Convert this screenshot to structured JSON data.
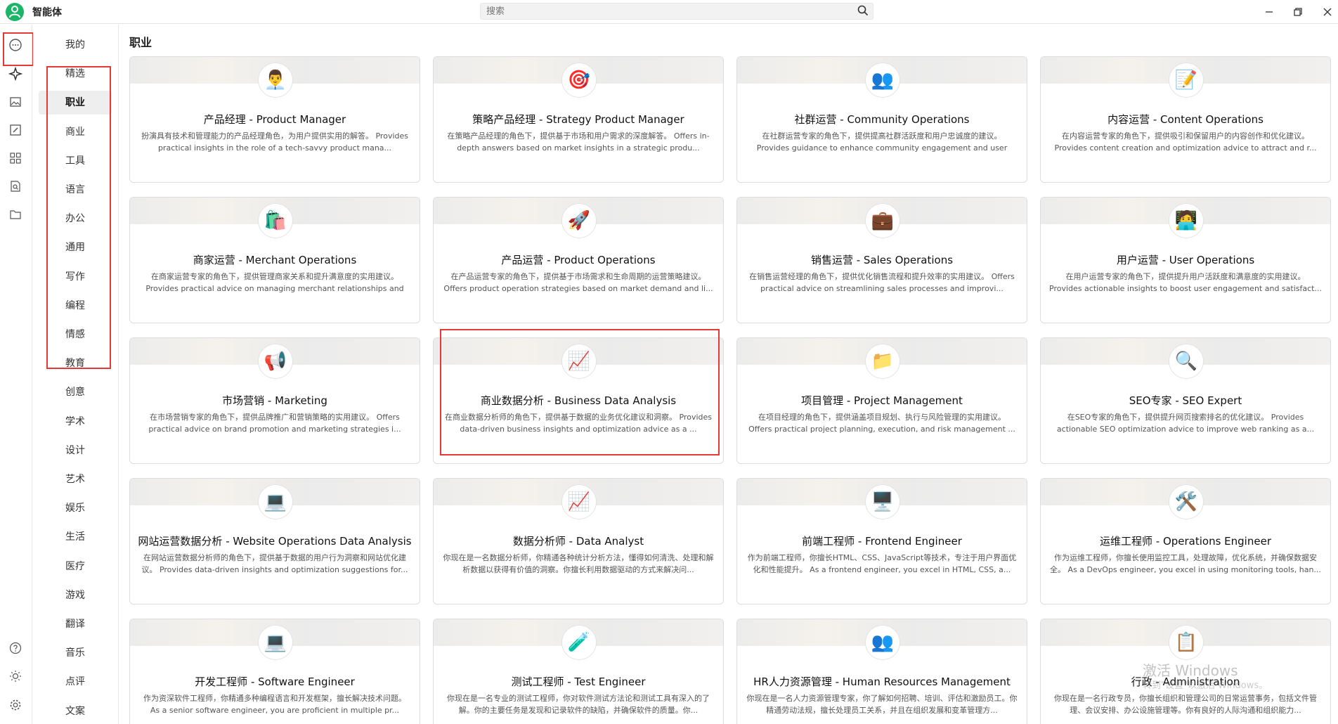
{
  "app": {
    "title": "智能体"
  },
  "search": {
    "placeholder": "搜索"
  },
  "rail": {
    "icons": [
      "chat-icon",
      "agent-icon",
      "image-icon",
      "paint-icon",
      "apps-icon",
      "doc-search-icon",
      "folder-icon",
      "help-icon",
      "theme-icon",
      "settings-icon"
    ]
  },
  "categories": [
    "我的",
    "精选",
    "职业",
    "商业",
    "工具",
    "语言",
    "办公",
    "通用",
    "写作",
    "编程",
    "情感",
    "教育",
    "创意",
    "学术",
    "设计",
    "艺术",
    "娱乐",
    "生活",
    "医疗",
    "游戏",
    "翻译",
    "音乐",
    "点评",
    "文案"
  ],
  "active_category": "职业",
  "section": {
    "title": "职业"
  },
  "cards": [
    {
      "icon": "👨‍💼",
      "title": "产品经理 - Product Manager",
      "desc": "扮演具有技术和管理能力的产品经理角色，为用户提供实用的解答。 Provides practical insights in the role of a tech-savvy product mana..."
    },
    {
      "icon": "🎯",
      "title": "策略产品经理 - Strategy Product Manager",
      "desc": "在策略产品经理的角色下，提供基于市场和用户需求的深度解答。 Offers in-depth answers based on market insights in a strategic produ..."
    },
    {
      "icon": "👥",
      "title": "社群运营 - Community Operations",
      "desc": "在社群运营专家的角色下，提供提高社群活跃度和用户忠诚度的建议。 Provides guidance to enhance community engagement and user loyalty ..."
    },
    {
      "icon": "📝",
      "title": "内容运营 - Content Operations",
      "desc": "在内容运营专家的角色下，提供吸引和保留用户的内容创作和优化建议。 Provides content creation and optimization advice to attract and r..."
    },
    {
      "icon": "🛍️",
      "title": "商家运营 - Merchant Operations",
      "desc": "在商家运营专家的角色下，提供管理商家关系和提升满意度的实用建议。 Provides practical advice on managing merchant relationships and e..."
    },
    {
      "icon": "🚀",
      "title": "产品运营 - Product Operations",
      "desc": "在产品运营专家的角色下，提供基于市场需求和生命周期的运营策略建议。 Offers product operation strategies based on market demand and li..."
    },
    {
      "icon": "💼",
      "title": "销售运营 - Sales Operations",
      "desc": "在销售运营经理的角色下，提供优化销售流程和提升效率的实用建议。 Offers practical advice on streamlining sales processes and improvi..."
    },
    {
      "icon": "🧑‍💻",
      "title": "用户运营 - User Operations",
      "desc": "在用户运营专家的角色下，提供提升用户活跃度和满意度的实用建议。 Provides actionable insights to boost user engagement and satisfact..."
    },
    {
      "icon": "📢",
      "title": "市场营销 - Marketing",
      "desc": "在市场营销专家的角色下，提供品牌推广和营销策略的实用建议。 Offers practical advice on brand promotion and marketing strategies i..."
    },
    {
      "icon": "📈",
      "title": "商业数据分析 - Business Data Analysis",
      "desc": "在商业数据分析师的角色下，提供基于数据的业务优化建议和洞察。 Provides data-driven business insights and optimization advice as a ..."
    },
    {
      "icon": "📁",
      "title": "项目管理 - Project Management",
      "desc": "在项目经理的角色下，提供涵盖项目规划、执行与风险管理的实用建议。 Offers practical project planning, execution, and risk management ..."
    },
    {
      "icon": "🔍",
      "title": "SEO专家 - SEO Expert",
      "desc": "在SEO专家的角色下，提供提升网页搜索排名的优化建议。 Provides actionable SEO optimization advice to improve web ranking as a..."
    },
    {
      "icon": "💻",
      "title": "网站运营数据分析 - Website Operations Data Analysis",
      "desc": "在网站运营数据分析师的角色下，提供基于数据的用户行为洞察和网站优化建议。 Provides data-driven insights and optimization suggestions for..."
    },
    {
      "icon": "📈",
      "title": "数据分析师 - Data Analyst",
      "desc": "你现在是一名数据分析师，你精通各种统计分析方法，懂得如何清洗、处理和解析数据以获得有价值的洞察。你擅长利用数据驱动的方式来解决问..."
    },
    {
      "icon": "🖥️",
      "title": "前端工程师 - Frontend Engineer",
      "desc": "作为前端工程师，你擅长HTML、CSS、JavaScript等技术，专注于用户界面优化和性能提升。 As a frontend engineer, you excel in HTML, CSS, a..."
    },
    {
      "icon": "🛠️",
      "title": "运维工程师 - Operations Engineer",
      "desc": "作为运维工程师，你擅长使用监控工具，处理故障，优化系统，并确保数据安全。 As a DevOps engineer, you excel in using monitoring tools, han..."
    },
    {
      "icon": "💻",
      "title": "开发工程师 - Software Engineer",
      "desc": "作为资深软件工程师，你精通多种编程语言和开发框架，擅长解决技术问题。 As a senior software engineer, you are proficient in multiple pr..."
    },
    {
      "icon": "🧪",
      "title": "测试工程师 - Test Engineer",
      "desc": "你现在是一名专业的测试工程师，你对软件测试方法论和测试工具有深入的了解。你的主要任务是发现和记录软件的缺陷，并确保软件的质量。你..."
    },
    {
      "icon": "👥",
      "title": "HR人力资源管理 - Human Resources Management",
      "desc": "你现在是一名人力资源管理专家，你了解如何招聘、培训、评估和激励员工。你精通劳动法规，擅长处理员工关系，并且在组织发展和变革管理方..."
    },
    {
      "icon": "📋",
      "title": "行政 - Administration",
      "desc": "你现在是一名行政专员，你擅长组织和管理公司的日常运营事务，包括文件管理、会议安排、办公设施管理等。你有良好的人际沟通和组织能力..."
    }
  ],
  "watermark": {
    "line1": "激活 Windows",
    "line2": "转到\"设置\"以激活 Windows。"
  },
  "colors": {
    "accent": "#1bb568",
    "highlight": "#e53935"
  }
}
